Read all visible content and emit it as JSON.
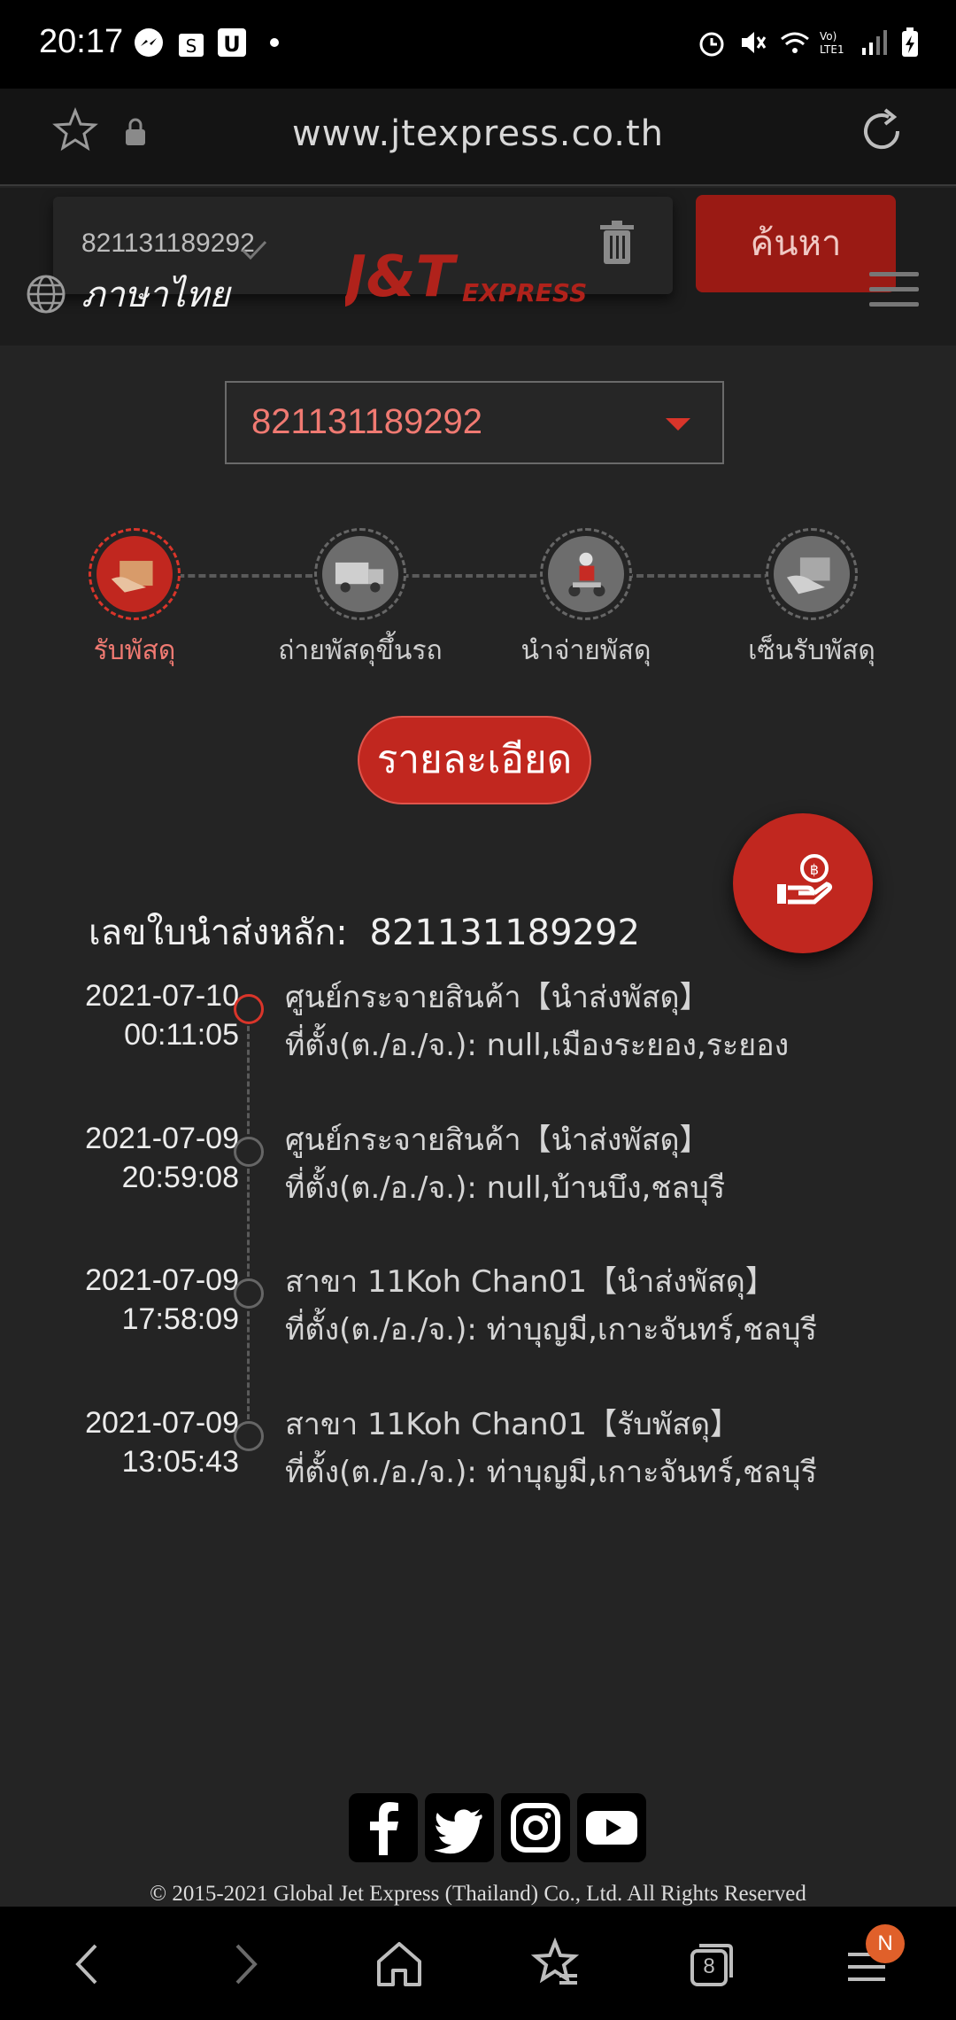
{
  "status_bar": {
    "time": "20:17",
    "icons": [
      "messenger-icon",
      "shopee-icon",
      "u-app-icon",
      "dot-icon",
      "alarm-icon",
      "mute-icon",
      "wifi-icon",
      "volte-icon",
      "signal-icon",
      "battery-charging-icon"
    ]
  },
  "browser": {
    "url": "www.jtexpress.co.th"
  },
  "header": {
    "search_value": "821131189292",
    "search_button": "ค้นหา",
    "language": "ภาษาไทย",
    "logo_text_main": "J&T",
    "logo_text_sub": "EXPRESS"
  },
  "tracking": {
    "selected_number": "821131189292",
    "steps": [
      {
        "label": "รับพัสดุ",
        "active": true
      },
      {
        "label": "ถ่ายพัสดุขึ้นรถ",
        "active": false
      },
      {
        "label": "นำจ่ายพัสดุ",
        "active": false
      },
      {
        "label": "เซ็นรับพัสดุ",
        "active": false
      }
    ],
    "detail_button": "รายละเอียด",
    "waybill_label": "เลขใบนำส่งหลัก:",
    "waybill_number": "821131189292",
    "events": [
      {
        "date": "2021-07-10",
        "time": "00:11:05",
        "title": "ศูนย์กระจายสินค้า【นำส่งพัสดุ】",
        "location_label": "ที่ตั้ง(ต./อ./จ.):",
        "location": "null,เมืองระยอง,ระยอง"
      },
      {
        "date": "2021-07-09",
        "time": "20:59:08",
        "title": "ศูนย์กระจายสินค้า【นำส่งพัสดุ】",
        "location_label": "ที่ตั้ง(ต./อ./จ.):",
        "location": "null,บ้านบึง,ชลบุรี"
      },
      {
        "date": "2021-07-09",
        "time": "17:58:09",
        "title": "สาขา 11Koh Chan01【นำส่งพัสดุ】",
        "location_label": "ที่ตั้ง(ต./อ./จ.):",
        "location": "ท่าบุญมี,เกาะจันทร์,ชลบุรี"
      },
      {
        "date": "2021-07-09",
        "time": "13:05:43",
        "title": "สาขา 11Koh Chan01【รับพัสดุ】",
        "location_label": "ที่ตั้ง(ต./อ./จ.):",
        "location": "ท่าบุญมี,เกาะจันทร์,ชลบุรี"
      }
    ]
  },
  "footer": {
    "social": [
      "facebook-icon",
      "twitter-icon",
      "instagram-icon",
      "youtube-icon"
    ],
    "copyright": "© 2015-2021 Global Jet Express (Thailand) Co., Ltd. All Rights Reserved"
  },
  "nav": {
    "tabs_count": "8",
    "badge": "N"
  },
  "colors": {
    "brand_red": "#c1271f",
    "accent_text": "#f07a72",
    "background": "#242424"
  }
}
